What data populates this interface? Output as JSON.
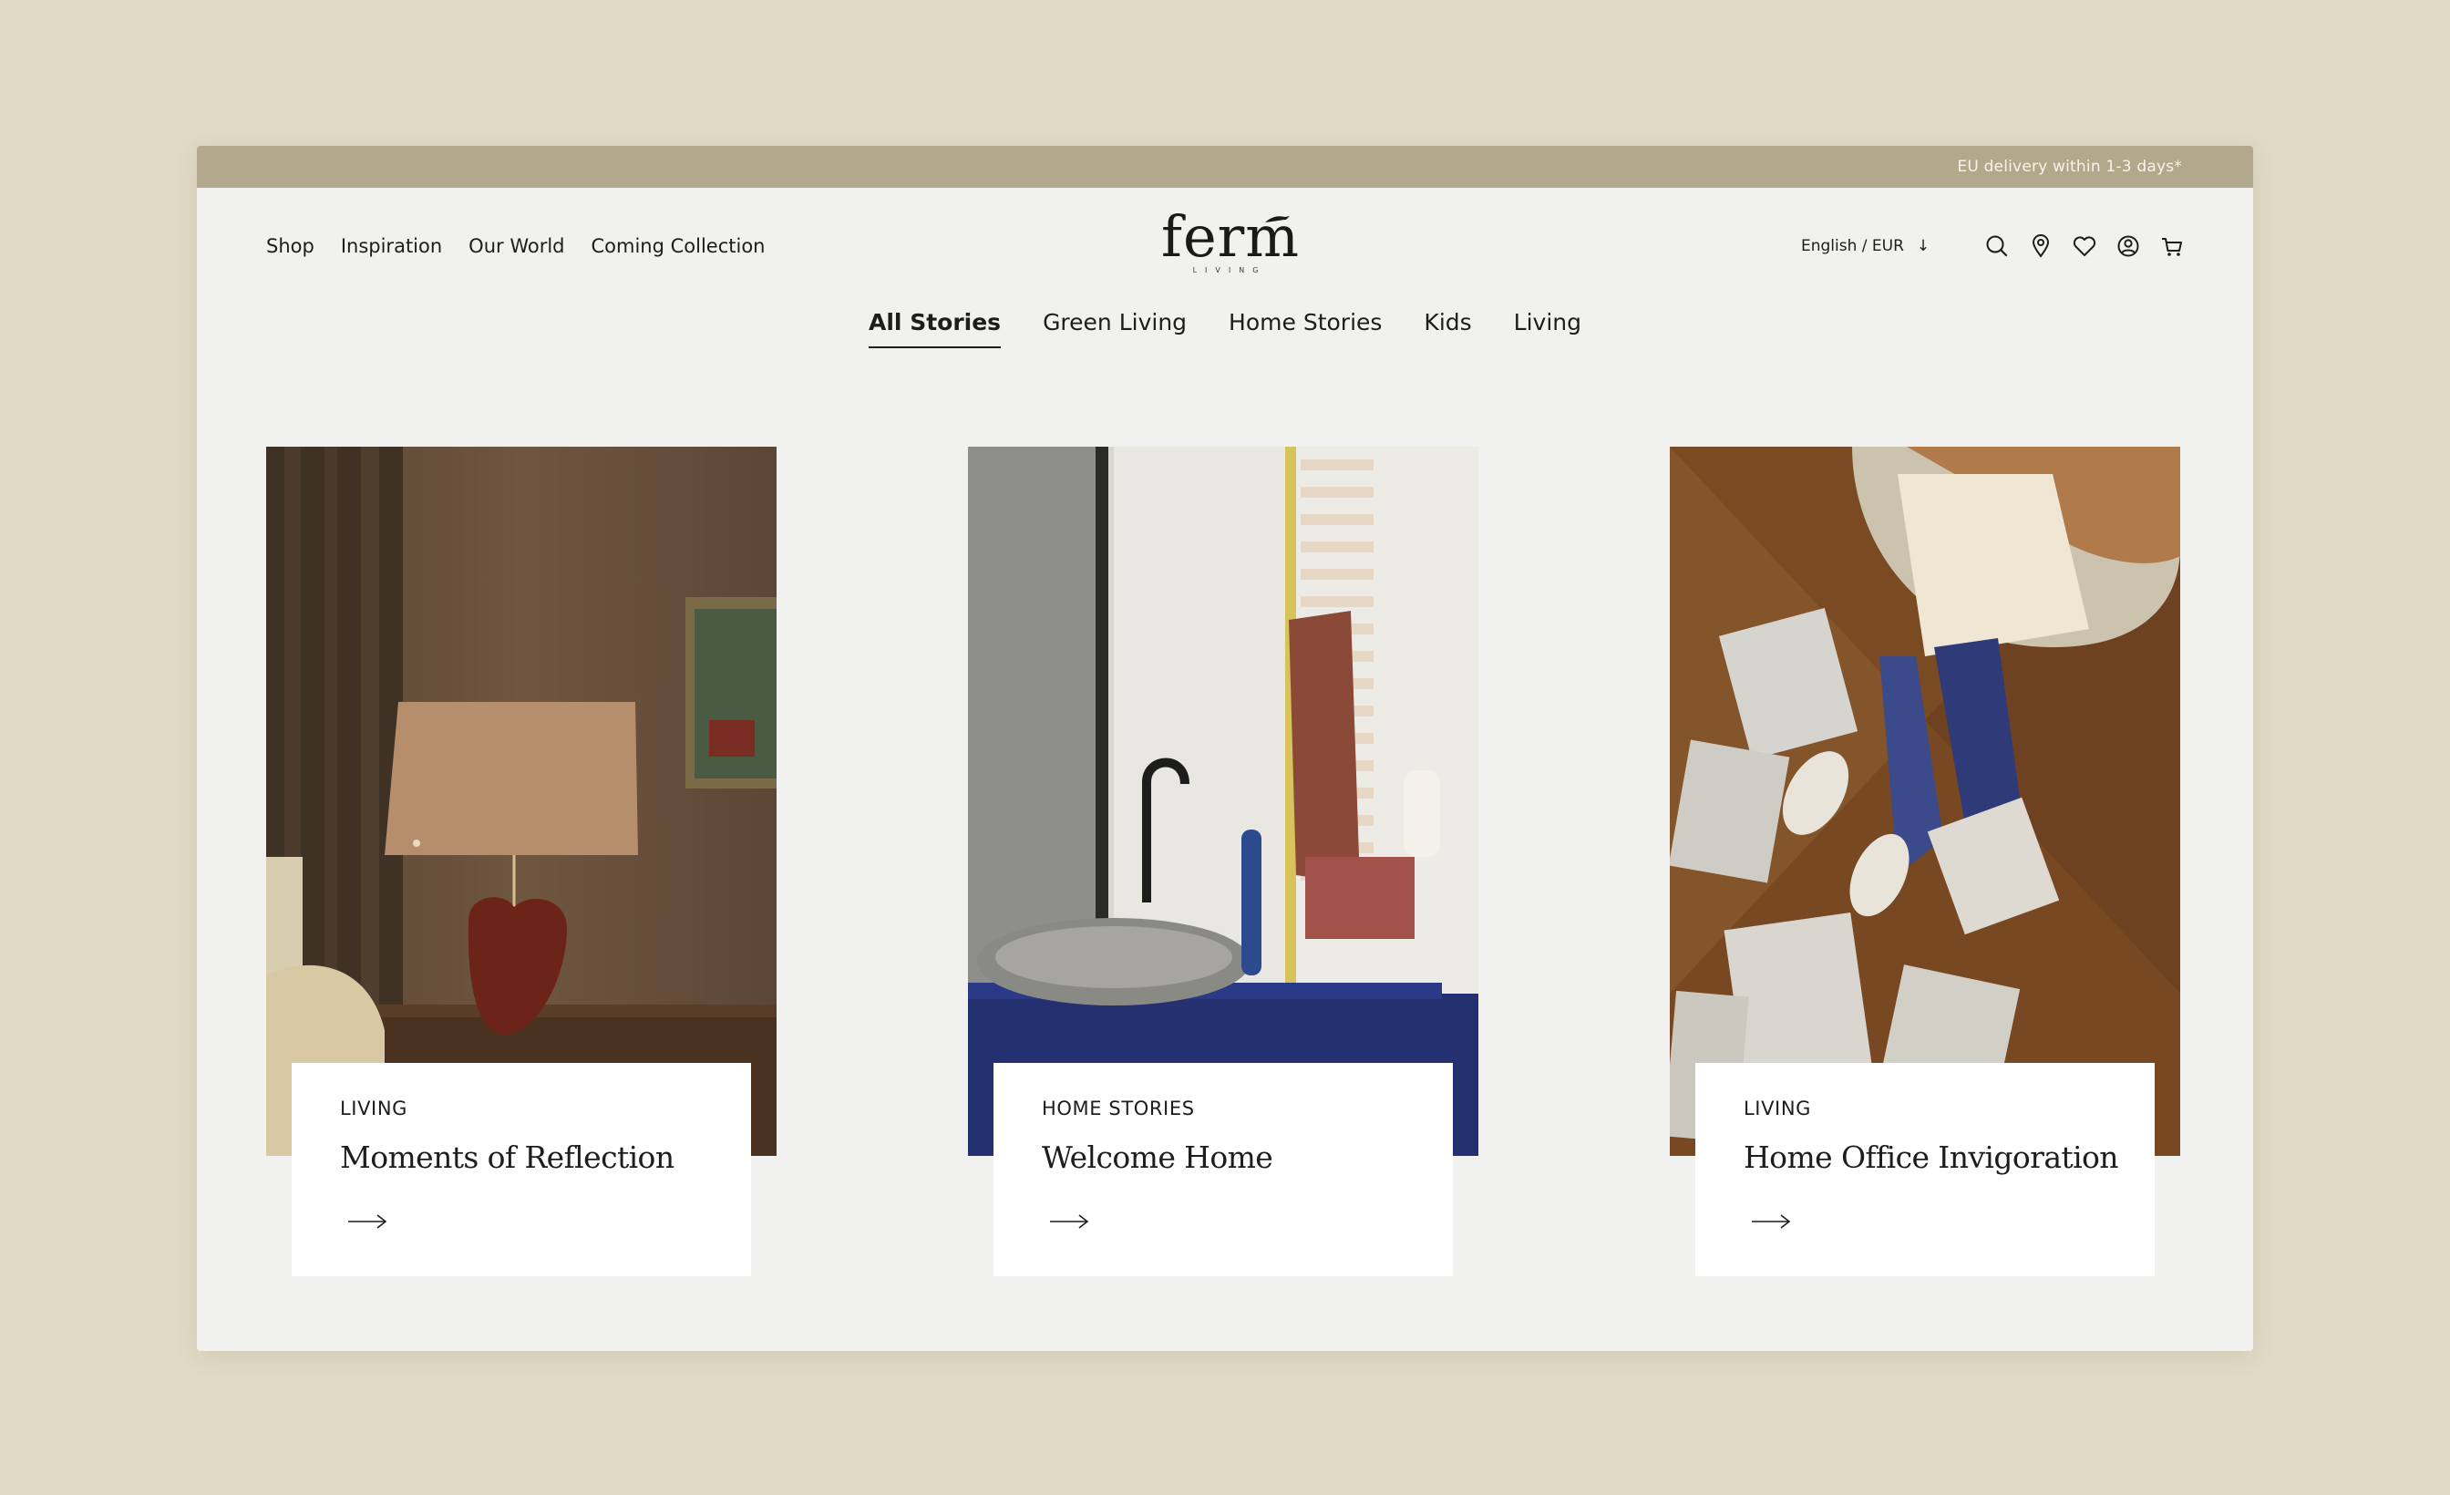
{
  "topbar": {
    "delivery_text": "EU delivery within 1-3 days*"
  },
  "nav": {
    "items": [
      "Shop",
      "Inspiration",
      "Our World",
      "Coming Collection"
    ]
  },
  "logo": {
    "word": "ferm",
    "sub": "LIVING"
  },
  "locale": {
    "label": "English / EUR",
    "arrow": "↓"
  },
  "header_icons": [
    "search-icon",
    "location-pin-icon",
    "heart-icon",
    "account-icon",
    "cart-icon"
  ],
  "subnav": {
    "tabs": [
      "All Stories",
      "Green Living",
      "Home Stories",
      "Kids",
      "Living"
    ],
    "active": "All Stories"
  },
  "cards": [
    {
      "category": "LIVING",
      "title": "Moments of Reflection"
    },
    {
      "category": "HOME STORIES",
      "title": "Welcome Home"
    },
    {
      "category": "LIVING",
      "title": "Home Office Invigoration"
    }
  ],
  "colors": {
    "background": "#e0dac6",
    "window": "#f1f1ef",
    "topbar": "#b2a98c",
    "card_panel": "#ffffff",
    "text": "#1d1d1b"
  }
}
